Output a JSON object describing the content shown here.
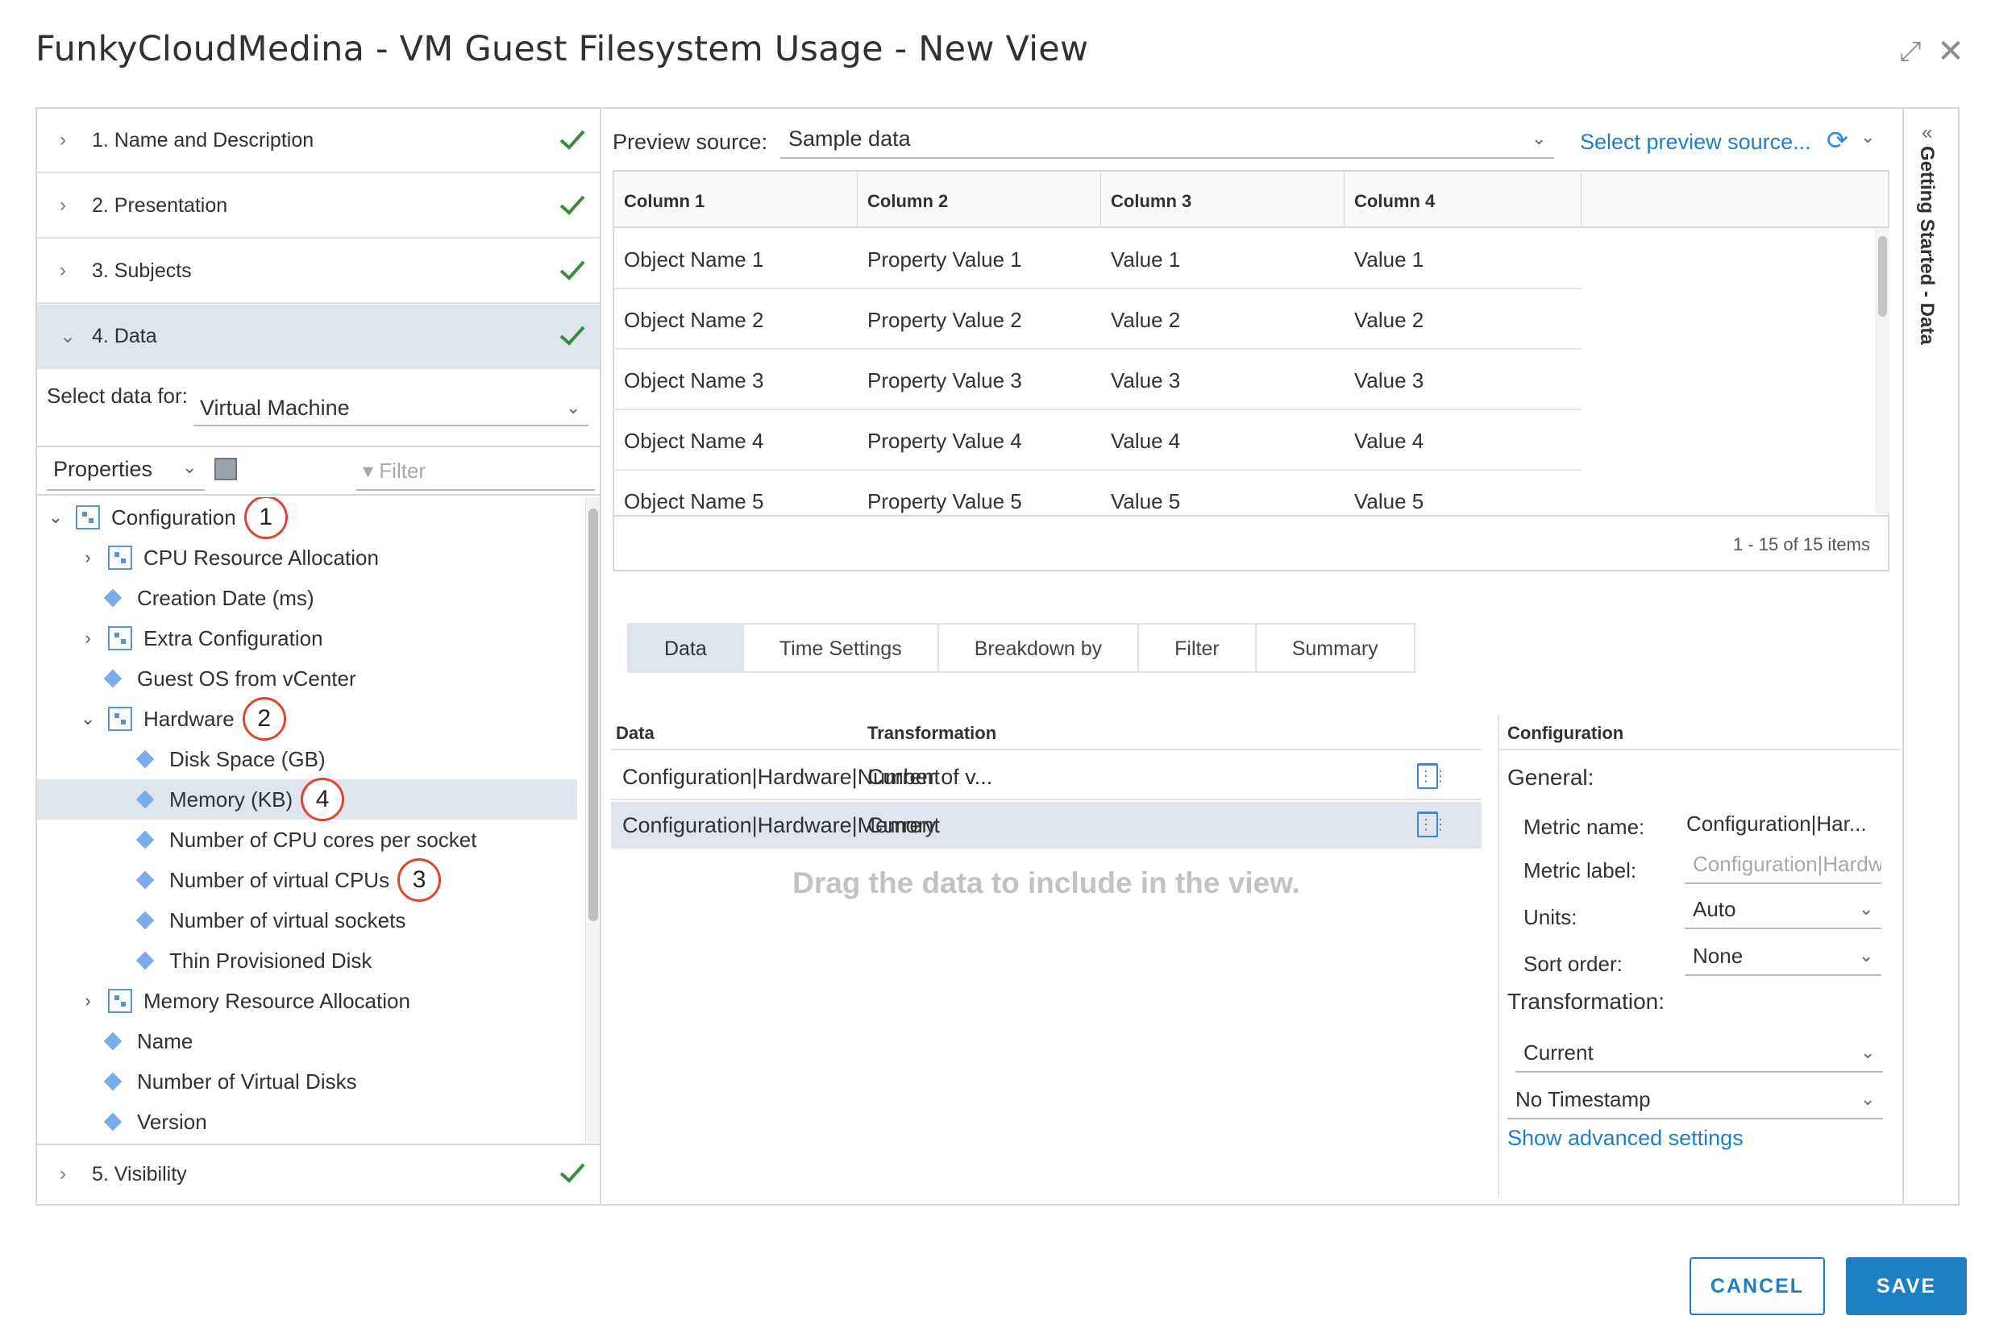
{
  "dialog": {
    "title": "FunkyCloudMedina - VM Guest Filesystem Usage - New View",
    "expand_icon": "expand-icon",
    "close_icon": "close-icon"
  },
  "steps": [
    {
      "label": "1. Name and Description",
      "complete": true
    },
    {
      "label": "2. Presentation",
      "complete": true
    },
    {
      "label": "3. Subjects",
      "complete": true
    },
    {
      "label": "4. Data",
      "complete": true,
      "expanded": true
    },
    {
      "label": "5. Visibility",
      "complete": true
    }
  ],
  "data_step": {
    "select_label": "Select data for:",
    "select_value": "Virtual Machine",
    "properties_value": "Properties",
    "filter_placeholder": "Filter"
  },
  "tree": [
    {
      "label": "Configuration",
      "level": 0,
      "kind": "group",
      "expanded": true,
      "callout": "1"
    },
    {
      "label": "CPU Resource Allocation",
      "level": 1,
      "kind": "group",
      "expanded": false
    },
    {
      "label": "Creation Date (ms)",
      "level": 1,
      "kind": "leaf"
    },
    {
      "label": "Extra Configuration",
      "level": 1,
      "kind": "group",
      "expanded": false
    },
    {
      "label": "Guest OS from vCenter",
      "level": 1,
      "kind": "leaf"
    },
    {
      "label": "Hardware",
      "level": 1,
      "kind": "group",
      "expanded": true,
      "callout": "2"
    },
    {
      "label": "Disk Space (GB)",
      "level": 2,
      "kind": "leaf"
    },
    {
      "label": "Memory (KB)",
      "level": 2,
      "kind": "leaf",
      "selected": true,
      "callout": "4"
    },
    {
      "label": "Number of CPU cores per socket",
      "level": 2,
      "kind": "leaf"
    },
    {
      "label": "Number of virtual CPUs",
      "level": 2,
      "kind": "leaf",
      "callout": "3"
    },
    {
      "label": "Number of virtual sockets",
      "level": 2,
      "kind": "leaf"
    },
    {
      "label": "Thin Provisioned Disk",
      "level": 2,
      "kind": "leaf"
    },
    {
      "label": "Memory Resource Allocation",
      "level": 1,
      "kind": "group",
      "expanded": false
    },
    {
      "label": "Name",
      "level": 1,
      "kind": "leaf"
    },
    {
      "label": "Number of Virtual Disks",
      "level": 1,
      "kind": "leaf"
    },
    {
      "label": "Version",
      "level": 1,
      "kind": "leaf"
    }
  ],
  "preview": {
    "label": "Preview source:",
    "value": "Sample data",
    "link": "Select preview source...",
    "columns": [
      "Column 1",
      "Column 2",
      "Column 3",
      "Column 4"
    ],
    "rows": [
      [
        "Object Name 1",
        "Property Value 1",
        "Value 1",
        "Value 1"
      ],
      [
        "Object Name 2",
        "Property Value 2",
        "Value 2",
        "Value 2"
      ],
      [
        "Object Name 3",
        "Property Value 3",
        "Value 3",
        "Value 3"
      ],
      [
        "Object Name 4",
        "Property Value 4",
        "Value 4",
        "Value 4"
      ],
      [
        "Object Name 5",
        "Property Value 5",
        "Value 5",
        "Value 5"
      ]
    ],
    "footer": "1 - 15 of 15 items"
  },
  "tabs": [
    {
      "label": "Data",
      "active": true
    },
    {
      "label": "Time Settings"
    },
    {
      "label": "Breakdown by"
    },
    {
      "label": "Filter"
    },
    {
      "label": "Summary"
    }
  ],
  "data_table": {
    "headers": {
      "data": "Data",
      "transformation": "Transformation"
    },
    "rows": [
      {
        "data": "Configuration|Hardware|Number of v...",
        "transformation": "Current",
        "selected": false
      },
      {
        "data": "Configuration|Hardware|Memory",
        "transformation": "Current",
        "selected": true
      }
    ],
    "hint": "Drag the data to include in the view."
  },
  "configuration": {
    "title": "Configuration",
    "general": "General:",
    "metric_name_label": "Metric name:",
    "metric_name_value": "Configuration|Har...",
    "metric_label_label": "Metric label:",
    "metric_label_placeholder": "Configuration|Hardware|Memory",
    "units_label": "Units:",
    "units_value": "Auto",
    "sort_label": "Sort order:",
    "sort_value": "None",
    "transformation_label": "Transformation:",
    "transformation_value": "Current",
    "timestamp_value": "No Timestamp",
    "advanced_link": "Show advanced settings"
  },
  "side_panel": {
    "label": "Getting Started - Data"
  },
  "footer": {
    "cancel": "CANCEL",
    "save": "SAVE"
  },
  "colors": {
    "accent": "#1f7fc3",
    "check": "#3c8c3c",
    "selected_bg": "#dfe5ec",
    "callout": "#d94630"
  }
}
